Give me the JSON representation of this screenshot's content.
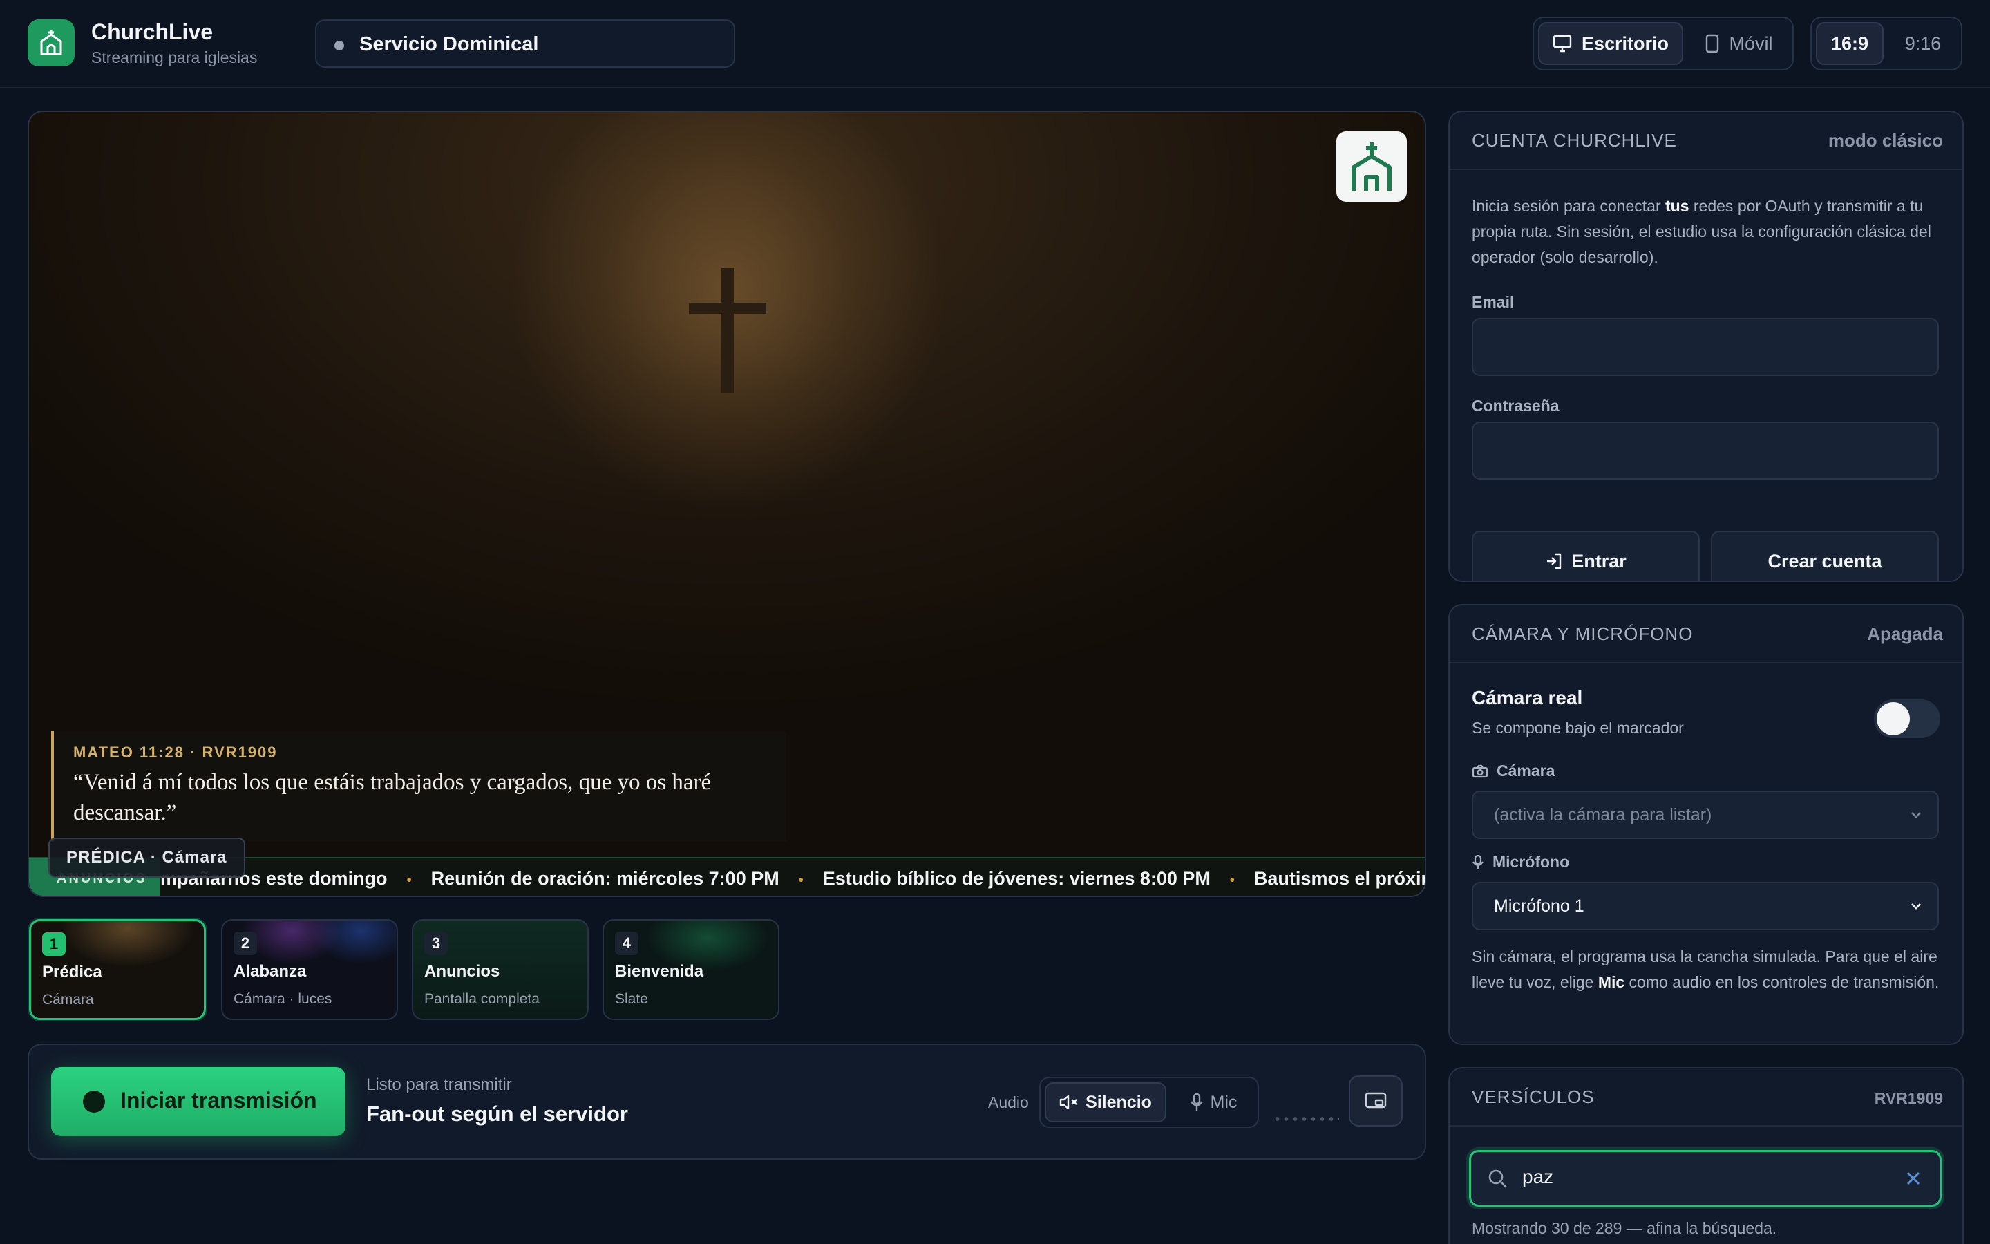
{
  "header": {
    "brand_name": "ChurchLive",
    "brand_sub": "Streaming para iglesias",
    "service_title": "Servicio Dominical",
    "view": {
      "desktop": "Escritorio",
      "mobile": "Móvil"
    },
    "ratio": {
      "landscape": "16:9",
      "portrait": "9:16"
    }
  },
  "preview": {
    "verse_ref": "MATEO 11:28 · RVR1909",
    "verse_text": "“Venid á mí todos los que estáis trabajados y cargados, que yo os haré descansar.”",
    "scene_tag": "PRÉDICA · Cámara",
    "ticker_label": "ANUNCIOS",
    "ticker_items": [
      "mpañarnos este domingo",
      "Reunión de oración: miércoles 7:00 PM",
      "Estudio bíblico de jóvenes: viernes 8:00 PM",
      "Bautismos el próximo domingo"
    ],
    "ticker_separator": "•"
  },
  "scenes": [
    {
      "num": "1",
      "name": "Prédica",
      "kind": "Cámara",
      "active": true
    },
    {
      "num": "2",
      "name": "Alabanza",
      "kind": "Cámara · luces",
      "active": false
    },
    {
      "num": "3",
      "name": "Anuncios",
      "kind": "Pantalla completa",
      "active": false
    },
    {
      "num": "4",
      "name": "Bienvenida",
      "kind": "Slate",
      "active": false
    }
  ],
  "controls": {
    "start_label": "Iniciar transmisión",
    "status": "Listo para transmitir",
    "mode": "Fan-out según el servidor",
    "audio_label": "Audio",
    "mute_label": "Silencio",
    "mic_label": "Mic"
  },
  "account": {
    "title": "CUENTA CHURCHLIVE",
    "meta": "modo clásico",
    "desc_pre": "Inicia sesión para conectar ",
    "desc_bold": "tus",
    "desc_post": " redes por OAuth y transmitir a tu propia ruta. Sin sesión, el estudio usa la configuración clásica del operador (solo desarrollo).",
    "email_label": "Email",
    "password_label": "Contraseña",
    "login_label": "Entrar",
    "signup_label": "Crear cuenta"
  },
  "media": {
    "title": "CÁMARA Y MICRÓFONO",
    "meta": "Apagada",
    "cam_title": "Cámara real",
    "cam_sub": "Se compone bajo el marcador",
    "camera_label": "Cámara",
    "camera_placeholder": "(activa la cámara para listar)",
    "mic_label": "Micrófono",
    "mic_value": "Micrófono 1",
    "note_pre": "Sin cámara, el programa usa la cancha simulada. Para que el aire lleve tu voz, elige ",
    "note_bold": "Mic",
    "note_post": " como audio en los controles de transmisión."
  },
  "verses": {
    "title": "VERSÍCULOS",
    "meta": "RVR1909",
    "query": "paz",
    "results": "Mostrando 30 de 289 — afina la búsqueda."
  },
  "colors": {
    "accent": "#27c17a",
    "background": "#0b1220",
    "panel": "#111a2a",
    "verse_gold": "#d4b26a"
  }
}
